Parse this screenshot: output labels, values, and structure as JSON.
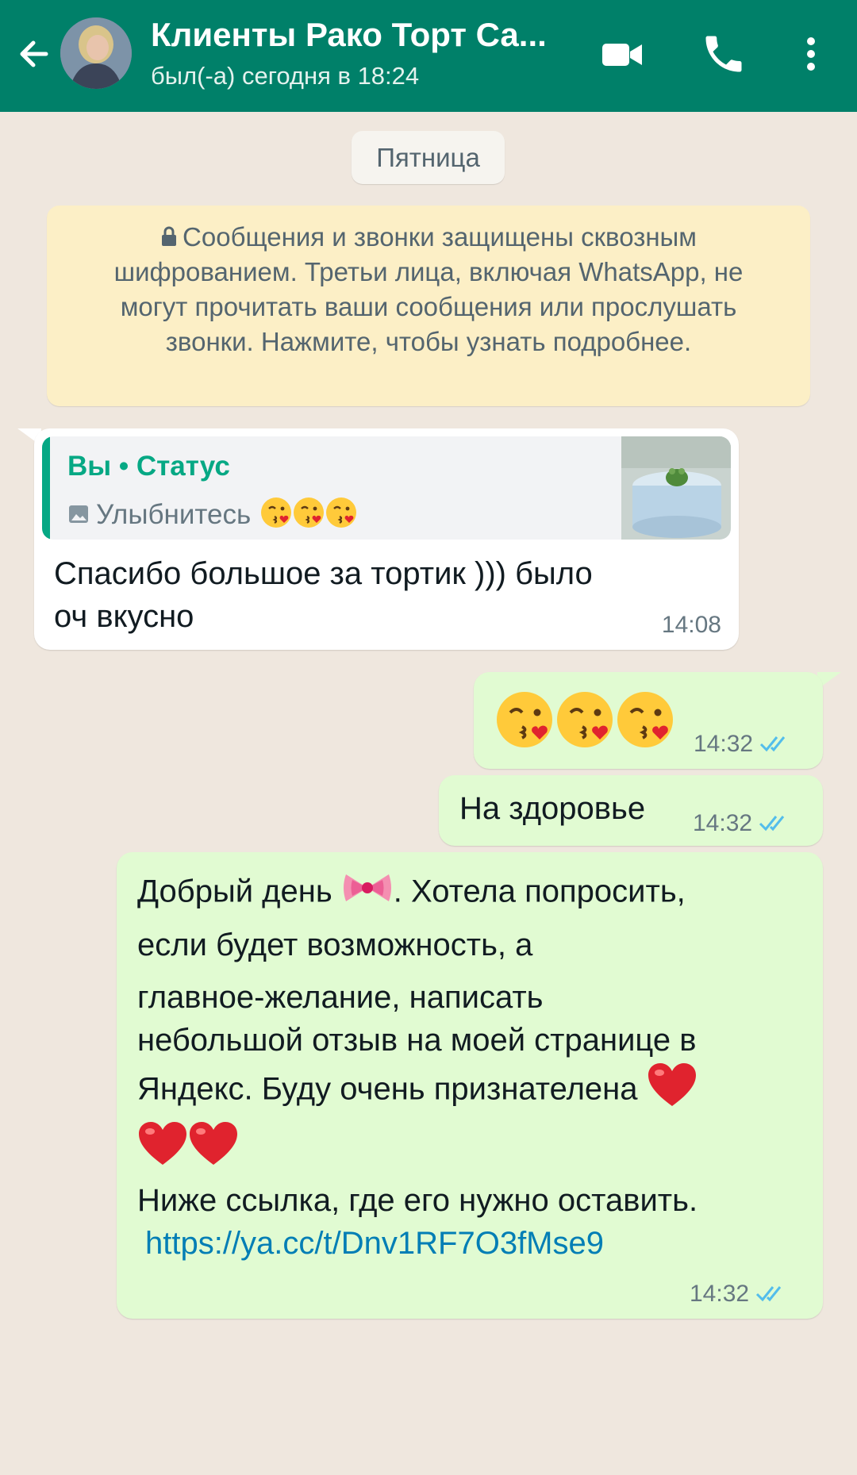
{
  "header": {
    "title": "Клиенты Рако Торт Са...",
    "subtitle": "был(-а) сегодня в 18:24",
    "background": "#008069"
  },
  "chat": {
    "date_chip": "Пятница",
    "encryption_notice": "Сообщения и звонки защищены сквозным шифрованием. Третьи лица, включая WhatsApp, не могут прочитать ваши сообщения или прослушать звонки. Нажмите, чтобы узнать подробнее.",
    "messages": [
      {
        "direction": "incoming",
        "quote": {
          "author": "Вы • Статус",
          "text": "Улыбнитесь",
          "emoji": "kiss-emoji x3",
          "thumbnail": "cake-photo"
        },
        "text": "Спасибо большое за тортик ))) было оч вкусно",
        "line1": "Спасибо большое за тортик ))) было",
        "line2": "оч вкусно",
        "time": "14:08"
      },
      {
        "direction": "outgoing",
        "content": "kiss-emoji x3",
        "time": "14:32",
        "status": "read"
      },
      {
        "direction": "outgoing",
        "text": "На здоровье",
        "time": "14:32",
        "status": "read"
      },
      {
        "direction": "outgoing",
        "line1_before": "Добрый день",
        "line1_after": ".  Хотела попросить,",
        "line2": "если будет возможность,  а",
        "line3": "главное-желание,  написать",
        "line4": "небольшой отзыв на моей странице в",
        "line5": "Яндекс.  Буду очень признателена",
        "line7": "Ниже ссылка, где его нужно оставить.",
        "link": "https://ya.cc/t/Dnv1RF7O3fMse9",
        "time": "14:32",
        "status": "read"
      }
    ]
  },
  "colors": {
    "incoming_bubble": "#ffffff",
    "outgoing_bubble": "#e1fbd2",
    "read_ticks": "#53bdeb",
    "link": "#027eb5",
    "quote_accent": "#06a884"
  }
}
